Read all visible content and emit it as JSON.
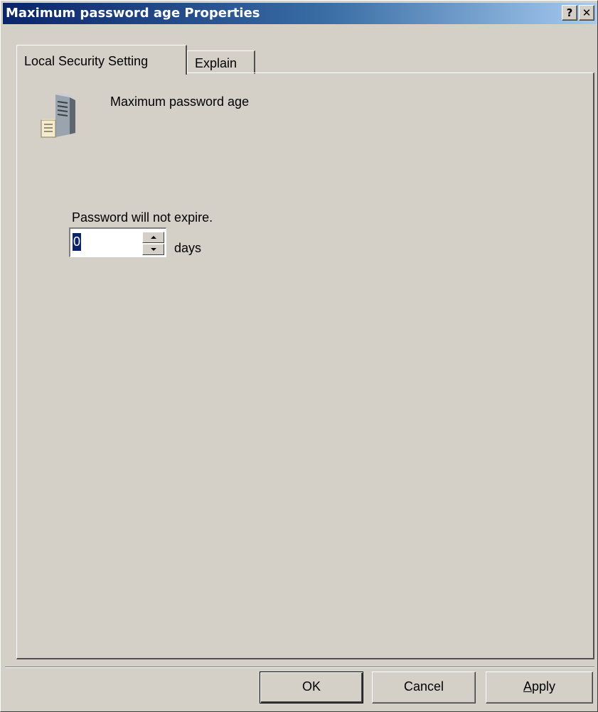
{
  "window": {
    "title": "Maximum password age Properties",
    "help_glyph": "?",
    "close_glyph": "✕"
  },
  "tabs": [
    {
      "label": "Local Security Setting",
      "active": true
    },
    {
      "label": "Explain",
      "active": false
    }
  ],
  "policy": {
    "icon": "server-policy-icon",
    "name": "Maximum password age"
  },
  "setting": {
    "status_text": "Password will not expire.",
    "value": "0",
    "unit": "days"
  },
  "buttons": {
    "ok": "OK",
    "cancel": "Cancel",
    "apply_accel": "A",
    "apply_rest": "pply"
  },
  "colors": {
    "title_gradient_start": "#0a246a",
    "title_gradient_end": "#a6caf0",
    "face": "#d4d0c8",
    "selection": "#0a246a"
  }
}
